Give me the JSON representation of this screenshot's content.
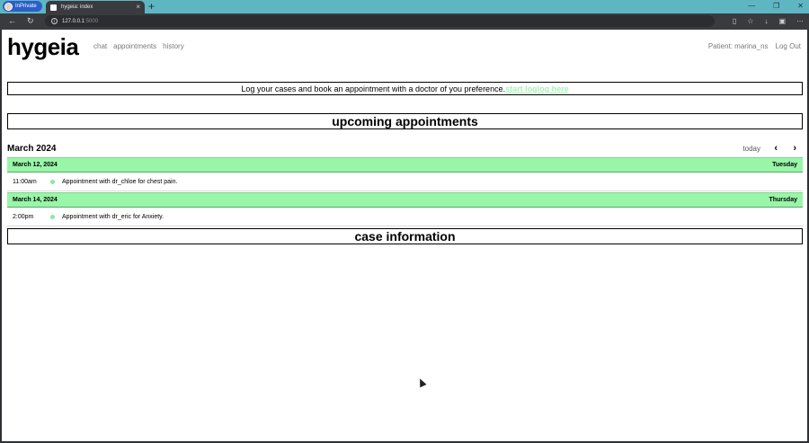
{
  "browser": {
    "inprivate_label": "InPrivate",
    "tab_title": "hygeia: index",
    "url_host": "127.0.0.1",
    "url_port": ":5000"
  },
  "app": {
    "brand": "hygeia",
    "nav": [
      "chat",
      "appointments",
      "history"
    ],
    "patient_label": "Patient: marina_ns",
    "logout_label": "Log Out"
  },
  "banner": {
    "text": "Log your cases and book an appointment with a doctor of you preference.",
    "cta": "start loglog here"
  },
  "upcoming": {
    "heading": "upcoming appointments",
    "month": "March 2024",
    "today_label": "today",
    "days": [
      {
        "date": "March 12, 2024",
        "weekday": "Tuesday",
        "events": [
          {
            "time": "11:00am",
            "title": "Appointment with dr_chloe for chest pain."
          }
        ]
      },
      {
        "date": "March 14, 2024",
        "weekday": "Thursday",
        "events": [
          {
            "time": "2:00pm",
            "title": "Appointment with dr_eric for Anxiety."
          }
        ]
      }
    ]
  },
  "case": {
    "heading": "case information"
  },
  "colors": {
    "accent_green": "#99f5a8",
    "cta_green": "#a6f0b6",
    "tab_strip": "#5fb6c3"
  }
}
